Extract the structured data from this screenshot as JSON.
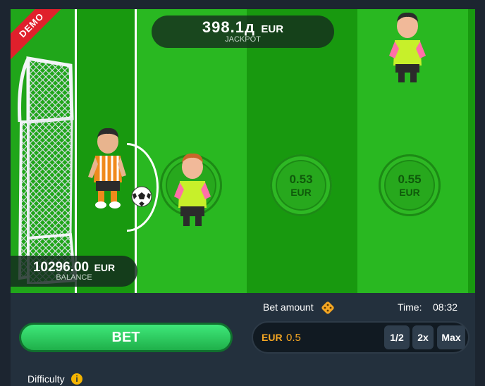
{
  "header": {
    "demo_badge": "DEMO"
  },
  "jackpot": {
    "amount": "398.1д",
    "currency": "EUR",
    "label": "JACKPOT"
  },
  "balance": {
    "amount": "10296.00",
    "currency": "EUR",
    "label": "BALANCE"
  },
  "coins": [
    {
      "value": "0.53",
      "currency": "EUR"
    },
    {
      "value": "0.55",
      "currency": "EUR"
    }
  ],
  "controls": {
    "bet_button": "BET",
    "bet_amount_label": "Bet amount",
    "time_label": "Time:",
    "time_value": "08:32",
    "bet_currency": "EUR",
    "bet_value": "0.5",
    "half_button": "1/2",
    "double_button": "2x",
    "max_button": "Max",
    "difficulty_label": "Difficulty",
    "info_icon_glyph": "i"
  },
  "colors": {
    "field_light": "#29b821",
    "field_dark": "#1a9c14",
    "accent_green": "#2fd46a",
    "currency_orange": "#f5a623",
    "demo_red": "#e0202c"
  }
}
